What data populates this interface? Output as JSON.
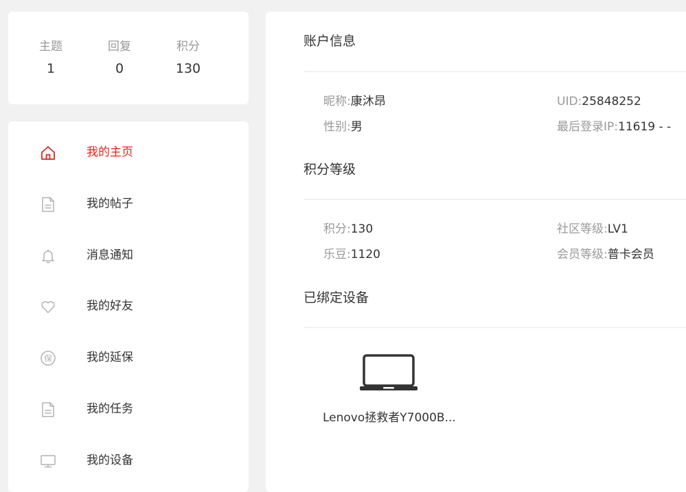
{
  "stats": [
    {
      "label": "主题",
      "value": "1"
    },
    {
      "label": "回复",
      "value": "0"
    },
    {
      "label": "积分",
      "value": "130"
    }
  ],
  "menu": [
    {
      "label": "我的主页",
      "active": true,
      "icon": "home-icon"
    },
    {
      "label": "我的帖子",
      "active": false,
      "icon": "document-icon"
    },
    {
      "label": "消息通知",
      "active": false,
      "icon": "bell-icon"
    },
    {
      "label": "我的好友",
      "active": false,
      "icon": "heart-icon"
    },
    {
      "label": "我的延保",
      "active": false,
      "icon": "warranty-icon",
      "icon_text": "保"
    },
    {
      "label": "我的任务",
      "active": false,
      "icon": "document-icon"
    },
    {
      "label": "我的设备",
      "active": false,
      "icon": "monitor-icon"
    }
  ],
  "account": {
    "title": "账户信息",
    "nickname_label": "昵称:",
    "nickname": "康沐昂",
    "uid_label": "UID:",
    "uid": "25848252",
    "gender_label": "性别:",
    "gender": "男",
    "last_ip_label": "最后登录IP:",
    "last_ip": "11619 - -"
  },
  "points": {
    "title": "积分等级",
    "points_label": "积分:",
    "points": "130",
    "level_label": "社区等级:",
    "level": "LV1",
    "ledou_label": "乐豆:",
    "ledou": "1120",
    "member_label": "会员等级:",
    "member": "普卡会员"
  },
  "devices": {
    "title": "已绑定设备",
    "items": [
      {
        "name": "Lenovo拯救者Y7000B...",
        "icon": "laptop-icon"
      }
    ]
  },
  "colors": {
    "accent": "#e1251b",
    "muted_text": "#999999",
    "body_text": "#333333",
    "icon_gray": "#b3b3b3",
    "page_bg": "#f1f1f1"
  }
}
